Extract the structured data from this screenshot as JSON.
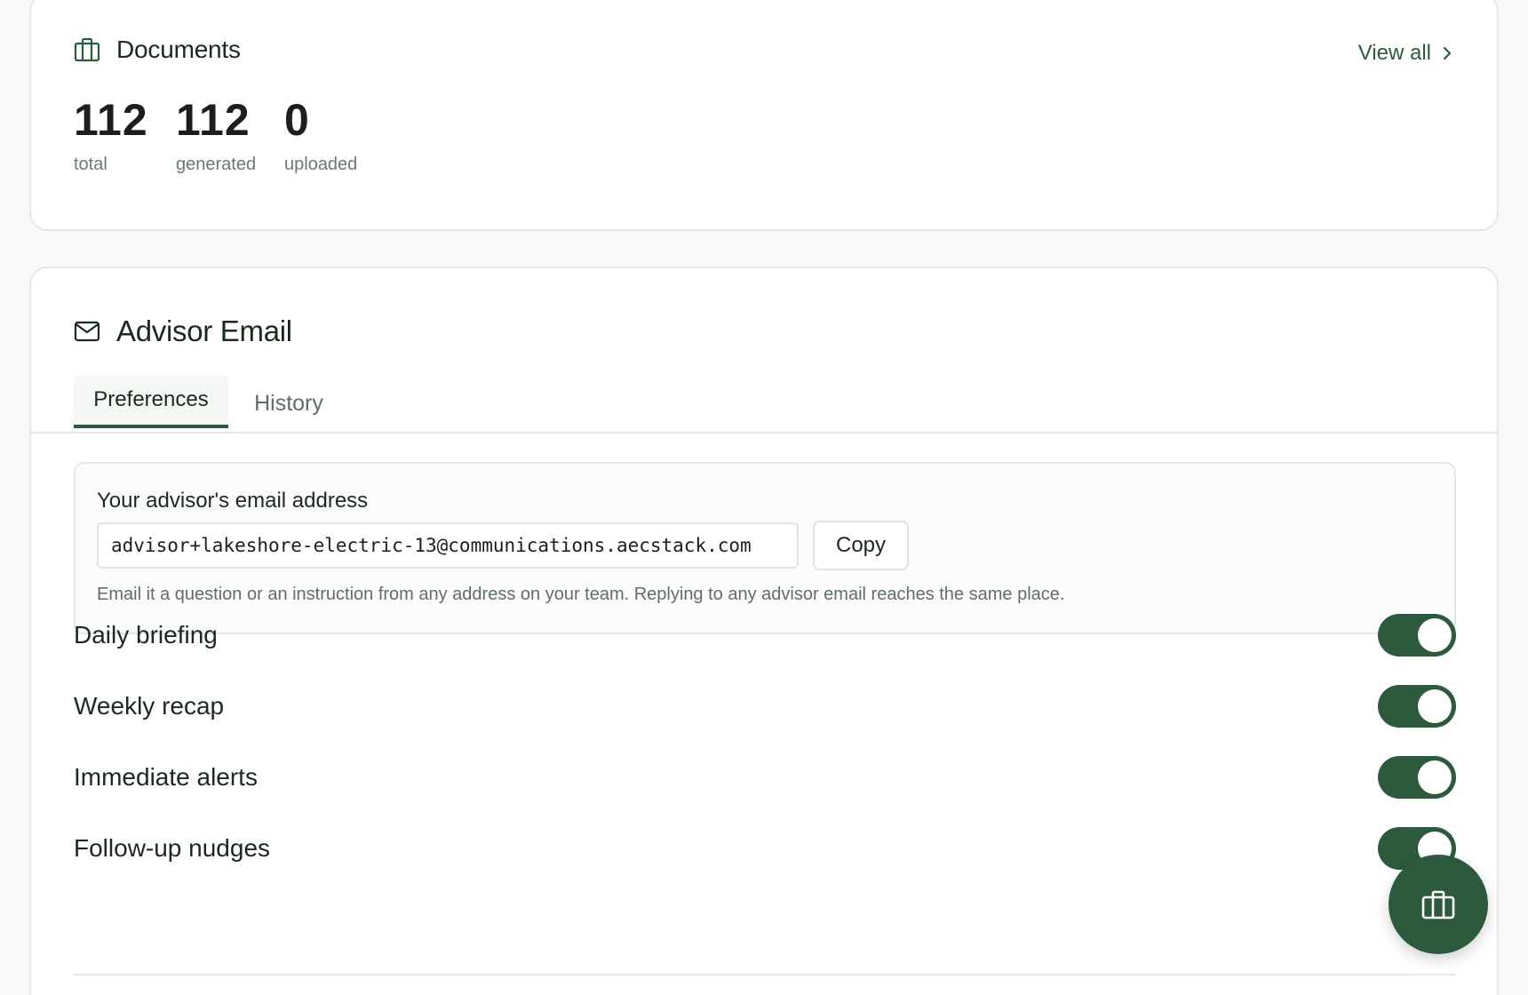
{
  "documents": {
    "title": "Documents",
    "view_all_label": "View all",
    "stats": [
      {
        "value": "112",
        "label": "total"
      },
      {
        "value": "112",
        "label": "generated"
      },
      {
        "value": "0",
        "label": "uploaded"
      }
    ]
  },
  "advisor_email": {
    "title": "Advisor Email",
    "tabs": [
      {
        "label": "Preferences",
        "active": true
      },
      {
        "label": "History",
        "active": false
      }
    ],
    "address_label": "Your advisor's email address",
    "address_value": "advisor+lakeshore-electric-13@communications.aecstack.com",
    "copy_label": "Copy",
    "help_text": "Email it a question or an instruction from any address on your team. Replying to any advisor email reaches the same place.",
    "preferences": [
      {
        "label": "Daily briefing",
        "enabled": true
      },
      {
        "label": "Weekly recap",
        "enabled": true
      },
      {
        "label": "Immediate alerts",
        "enabled": true
      },
      {
        "label": "Follow-up nudges",
        "enabled": true
      }
    ]
  },
  "icons": {
    "documents": "briefcase-icon",
    "advisor_email": "mail-icon",
    "view_all": "chevron-right-icon",
    "fab": "briefcase-icon"
  },
  "colors": {
    "accent": "#2d5a3d",
    "border": "#e3e9e4",
    "muted_text": "#6b7a70"
  }
}
